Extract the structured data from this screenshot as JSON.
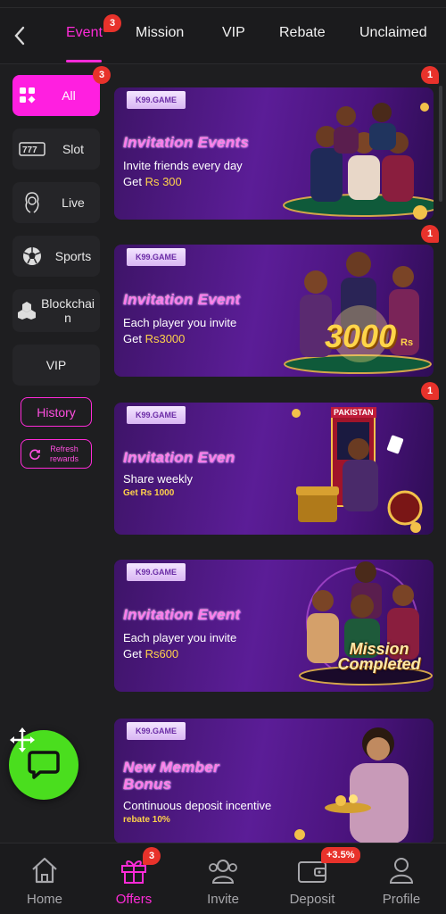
{
  "tabs": [
    {
      "label": "Event",
      "badge": "3",
      "active": true
    },
    {
      "label": "Mission"
    },
    {
      "label": "VIP"
    },
    {
      "label": "Rebate"
    },
    {
      "label": "Unclaimed"
    }
  ],
  "sidebar": {
    "items": [
      {
        "label": "All",
        "badge": "3",
        "icon": "grid-icon"
      },
      {
        "label": "Slot",
        "icon": "slot-icon"
      },
      {
        "label": "Live",
        "icon": "live-dealer-icon"
      },
      {
        "label": "Sports",
        "icon": "soccer-ball-icon"
      },
      {
        "label": "Blockchai\nn",
        "icon": "blockchain-icon"
      },
      {
        "label": "VIP"
      }
    ],
    "history_label": "History",
    "refresh_label": "Refresh rewards"
  },
  "banners": [
    {
      "brand": "K99.GAME",
      "title": "Invitation Events",
      "sub": "Invite friends every day",
      "reward_prefix": "Get ",
      "reward_amount": "Rs 300",
      "badge": "1"
    },
    {
      "brand": "K99.GAME",
      "title": "Invitation Event",
      "sub": "Each player you invite",
      "reward_prefix": "Get ",
      "reward_amount": "Rs3000",
      "badge": "1",
      "art_text": "3000",
      "art_suffix": "Rs"
    },
    {
      "brand": "K99.GAME",
      "title": "Invitation Even",
      "sub": "Share weekly",
      "reward_prefix": "",
      "reward_amount": "Get Rs 1000",
      "badge": "1",
      "art_text": "PAKISTAN"
    },
    {
      "brand": "K99.GAME",
      "title": "Invitation Event",
      "sub": "Each player you invite",
      "reward_prefix": "Get ",
      "reward_amount": "Rs600",
      "art_text": "Mission Completed"
    },
    {
      "brand": "K99.GAME",
      "title": "New Member Bonus",
      "sub": "Continuous deposit incentive",
      "reward_prefix": "",
      "reward_amount": "rebate 10%"
    }
  ],
  "bottomnav": [
    {
      "label": "Home",
      "icon": "home-icon"
    },
    {
      "label": "Offers",
      "icon": "gift-icon",
      "badge": "3",
      "active": true
    },
    {
      "label": "Invite",
      "icon": "users-icon"
    },
    {
      "label": "Deposit",
      "icon": "wallet-icon",
      "badge": "+3.5%"
    },
    {
      "label": "Profile",
      "icon": "profile-icon"
    }
  ],
  "colors": {
    "accent": "#ff2bd8",
    "badge": "#e8322b",
    "fab": "#4ade1e",
    "banner": "#5b1d97"
  }
}
